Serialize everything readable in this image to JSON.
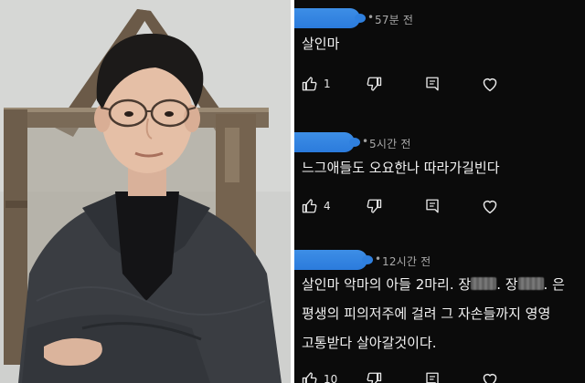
{
  "comments": [
    {
      "time": "57분 전",
      "lines": [
        "살인마"
      ],
      "likes": "1",
      "icons": [
        "thumbs-up-icon",
        "thumbs-down-icon",
        "reply-icon",
        "heart-icon"
      ]
    },
    {
      "time": "5시간 전",
      "lines": [
        "느그애들도 오요한나 따라가길빈다"
      ],
      "likes": "4",
      "icons": [
        "thumbs-up-icon",
        "thumbs-down-icon",
        "reply-icon",
        "heart-icon"
      ]
    },
    {
      "time": "12시간 전",
      "line1_a": "살인마 악마의 아들 2마리. 장",
      "line1_b": ". 장",
      "line1_c": ". 은",
      "lines": [
        "평생의 피의저주에 걸려 그 자손들까지 영영",
        "고통받다 살아갈것이다."
      ],
      "likes": "10",
      "icons": [
        "thumbs-up-icon",
        "thumbs-down-icon",
        "reply-icon",
        "heart-icon"
      ]
    }
  ],
  "colors": {
    "panel_bg": "#0b0b0b",
    "redaction": "#2b7bdc",
    "text": "#f3f3f3",
    "meta": "#a9a9a9"
  }
}
